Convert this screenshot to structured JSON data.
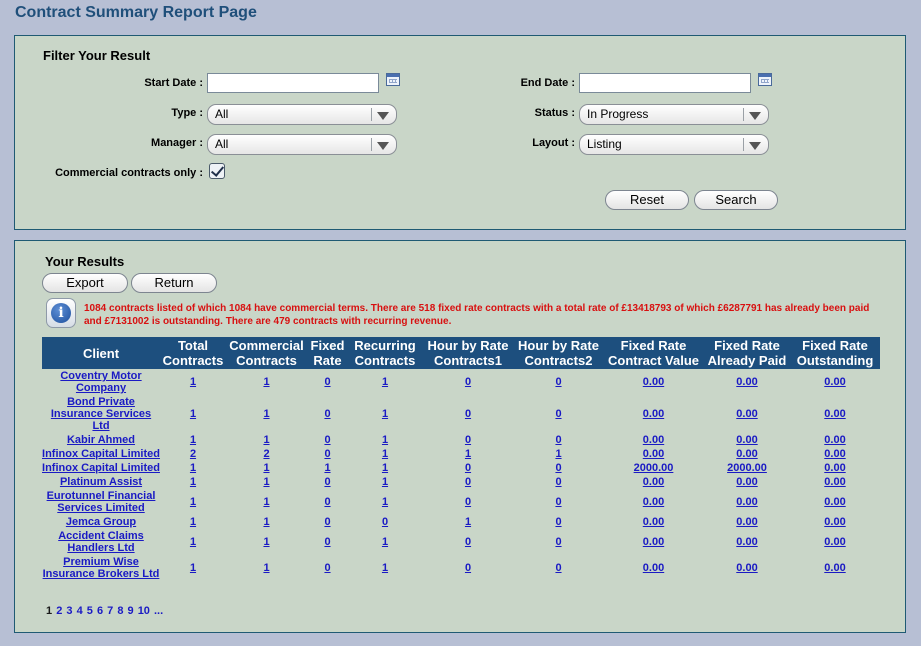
{
  "page": {
    "title": "Contract Summary Report Page"
  },
  "filter": {
    "title": "Filter Your Result",
    "start_date": {
      "label": "Start Date :",
      "value": ""
    },
    "end_date": {
      "label": "End Date :",
      "value": ""
    },
    "type": {
      "label": "Type :",
      "value": "All"
    },
    "status": {
      "label": "Status :",
      "value": "In Progress"
    },
    "manager": {
      "label": "Manager :",
      "value": "All"
    },
    "layout": {
      "label": "Layout :",
      "value": "Listing"
    },
    "commercial": {
      "label": "Commercial contracts only :",
      "checked": true
    },
    "reset_label": "Reset",
    "search_label": "Search"
  },
  "results": {
    "title": "Your Results",
    "export_label": "Export",
    "return_label": "Return",
    "message": "1084 contracts listed of which 1084 have commercial terms. There are 518 fixed rate contracts with a total rate of £13418793 of which £6287791 has already been paid and £7131002 is outstanding. There are 479 contracts with recurring revenue.",
    "columns": [
      "Client",
      "Total Contracts",
      "Commercial Contracts",
      "Fixed Rate",
      "Recurring Contracts",
      "Hour by Rate Contracts1",
      "Hour by Rate Contracts2",
      "Fixed Rate Contract Value",
      "Fixed Rate Already Paid",
      "Fixed Rate Outstanding"
    ],
    "rows": [
      {
        "client": "Coventry Motor Company",
        "total": "1",
        "commercial": "1",
        "fixed": "0",
        "recurring": "1",
        "hbr1": "0",
        "hbr2": "0",
        "value": "0.00",
        "paid": "0.00",
        "outstanding": "0.00"
      },
      {
        "client": "Bond Private Insurance Services Ltd",
        "total": "1",
        "commercial": "1",
        "fixed": "0",
        "recurring": "1",
        "hbr1": "0",
        "hbr2": "0",
        "value": "0.00",
        "paid": "0.00",
        "outstanding": "0.00"
      },
      {
        "client": "Kabir Ahmed",
        "total": "1",
        "commercial": "1",
        "fixed": "0",
        "recurring": "1",
        "hbr1": "0",
        "hbr2": "0",
        "value": "0.00",
        "paid": "0.00",
        "outstanding": "0.00"
      },
      {
        "client": "Infinox Capital Limited",
        "total": "2",
        "commercial": "2",
        "fixed": "0",
        "recurring": "1",
        "hbr1": "1",
        "hbr2": "1",
        "value": "0.00",
        "paid": "0.00",
        "outstanding": "0.00"
      },
      {
        "client": "Infinox Capital Limited",
        "total": "1",
        "commercial": "1",
        "fixed": "1",
        "recurring": "1",
        "hbr1": "0",
        "hbr2": "0",
        "value": "2000.00",
        "paid": "2000.00",
        "outstanding": "0.00"
      },
      {
        "client": "Platinum Assist",
        "total": "1",
        "commercial": "1",
        "fixed": "0",
        "recurring": "1",
        "hbr1": "0",
        "hbr2": "0",
        "value": "0.00",
        "paid": "0.00",
        "outstanding": "0.00"
      },
      {
        "client": "Eurotunnel Financial Services Limited",
        "total": "1",
        "commercial": "1",
        "fixed": "0",
        "recurring": "1",
        "hbr1": "0",
        "hbr2": "0",
        "value": "0.00",
        "paid": "0.00",
        "outstanding": "0.00"
      },
      {
        "client": "Jemca Group",
        "total": "1",
        "commercial": "1",
        "fixed": "0",
        "recurring": "0",
        "hbr1": "1",
        "hbr2": "0",
        "value": "0.00",
        "paid": "0.00",
        "outstanding": "0.00"
      },
      {
        "client": "Accident Claims Handlers Ltd",
        "total": "1",
        "commercial": "1",
        "fixed": "0",
        "recurring": "1",
        "hbr1": "0",
        "hbr2": "0",
        "value": "0.00",
        "paid": "0.00",
        "outstanding": "0.00"
      },
      {
        "client": "Premium Wise Insurance Brokers Ltd",
        "total": "1",
        "commercial": "1",
        "fixed": "0",
        "recurring": "1",
        "hbr1": "0",
        "hbr2": "0",
        "value": "0.00",
        "paid": "0.00",
        "outstanding": "0.00"
      }
    ],
    "pages": [
      "1",
      "2",
      "3",
      "4",
      "5",
      "6",
      "7",
      "8",
      "9",
      "10",
      "..."
    ]
  }
}
